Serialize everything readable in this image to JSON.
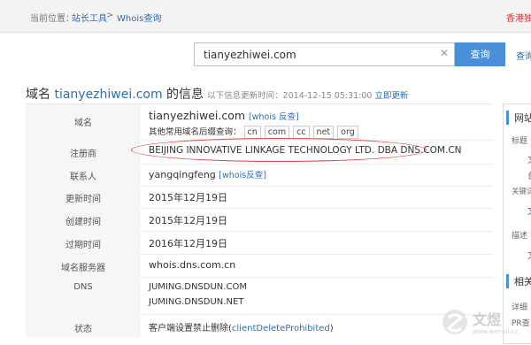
{
  "breadcrumb": {
    "prefix": "当前位置：",
    "home": "站长工具",
    "sep": ">",
    "current": "Whois查询",
    "right_promo": "香港独"
  },
  "search": {
    "value": "tianyezhiwei.com",
    "button_label": "查询",
    "alt_link": "查询"
  },
  "heading": {
    "prefix": "域名 ",
    "domain": "tianyezhiwei.com",
    "suffix": " 的信息",
    "updated_text": "以下信息更新时间：2014-12-15 05:31:00",
    "refresh_link": "立即更新"
  },
  "rows": {
    "domain": {
      "label": "域名",
      "value": "tianyezhiwei.com",
      "whois_link": "[whois 反查]",
      "suffix_prompt": "其他常用域名后缀查询：",
      "suffixes": [
        "cn",
        "com",
        "cc",
        "net",
        "org"
      ]
    },
    "registrar": {
      "label": "注册商",
      "value": "BEIJING INNOVATIVE LINKAGE TECHNOLOGY LTD. DBA DNS.COM.CN"
    },
    "contact": {
      "label": "联系人",
      "value": "yangqingfeng",
      "whois_link": "[whois反查]"
    },
    "updated": {
      "label": "更新时间",
      "value": "2015年12月19日"
    },
    "created": {
      "label": "创建时间",
      "value": "2015年12月19日"
    },
    "expires": {
      "label": "过期时间",
      "value": "2016年12月19日"
    },
    "server": {
      "label": "域名服务器",
      "value": "whois.dns.com.cn"
    },
    "dns": {
      "label": "DNS",
      "values": [
        "JUMING.DNSDUN.COM",
        "JUMING.DNSDUN.NET"
      ]
    },
    "status": {
      "label": "状态",
      "value_prefix": "客户端设置禁止删除(",
      "value_code": "clientDeleteProhibited",
      "value_suffix": ")"
    }
  },
  "sidebar": {
    "title": "网站",
    "label_title": "标题",
    "item1": "文",
    "item2": "台",
    "keywords": "关键词",
    "item3": "文",
    "desc": "描述",
    "item4": "文",
    "section2": "相关",
    "detail": "详细",
    "pr": "PR查"
  },
  "watermark": {
    "brand": "文煜",
    "url": "www.wenyu.cc"
  },
  "colors": {
    "accent": "#4a90d9",
    "link": "#2a6fb8",
    "annotation": "#dd4444"
  }
}
